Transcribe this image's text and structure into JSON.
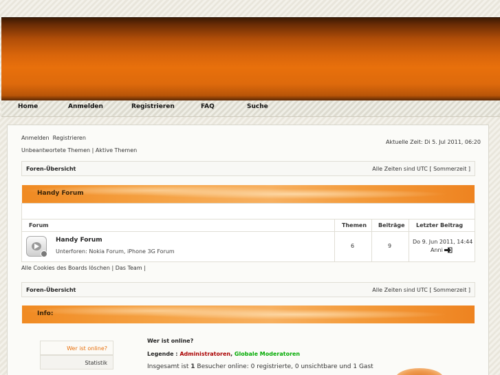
{
  "nav": {
    "home": "Home",
    "login": "Anmelden",
    "register": "Registrieren",
    "faq": "FAQ",
    "search": "Suche"
  },
  "user_links": {
    "login": "Anmelden",
    "register": "Registrieren"
  },
  "quick_links": "Unbeantwortete Themen | Aktive Themen",
  "current_time": "Aktuelle Zeit: Di 5. Jul 2011, 06:20",
  "breadcrumb_top": {
    "label": "Foren-Übersicht",
    "timezone": "Alle Zeiten sind UTC [ Sommerzeit ]"
  },
  "category": {
    "title": "Handy Forum"
  },
  "table": {
    "headers": {
      "forum": "Forum",
      "topics": "Themen",
      "posts": "Beiträge",
      "last_post": "Letzter Beitrag"
    },
    "rows": [
      {
        "name": "Handy Forum",
        "subforums": "Unterforen: Nokia Forum, iPhone 3G Forum",
        "topics": "6",
        "posts": "9",
        "last_date": "Do 9. Jun 2011, 14:44",
        "last_user": "Anni"
      }
    ]
  },
  "footer_links": "Alle Cookies des Boards löschen | Das Team |",
  "breadcrumb_bottom": {
    "label": "Foren-Übersicht",
    "timezone": "Alle Zeiten sind UTC [ Sommerzeit ]"
  },
  "info": {
    "title": "Info:",
    "tabs": [
      "Wer ist online?",
      "Statistik"
    ],
    "online_heading": "Wer ist online?",
    "legend_label": "Legende :",
    "legend_admins": "Administratoren",
    "legend_separator": ",",
    "legend_mods": "Globale Moderatoren",
    "users_prefix": "Insgesamt ist",
    "users_count": "1",
    "users_suffix": "Besucher online: 0 registrierte, 0 unsichtbare und 1 Gast"
  },
  "colors": {
    "accent": "#e8700c",
    "admin": "#aa0000",
    "moderator": "#00aa00",
    "active_tab": "#e8700c"
  }
}
